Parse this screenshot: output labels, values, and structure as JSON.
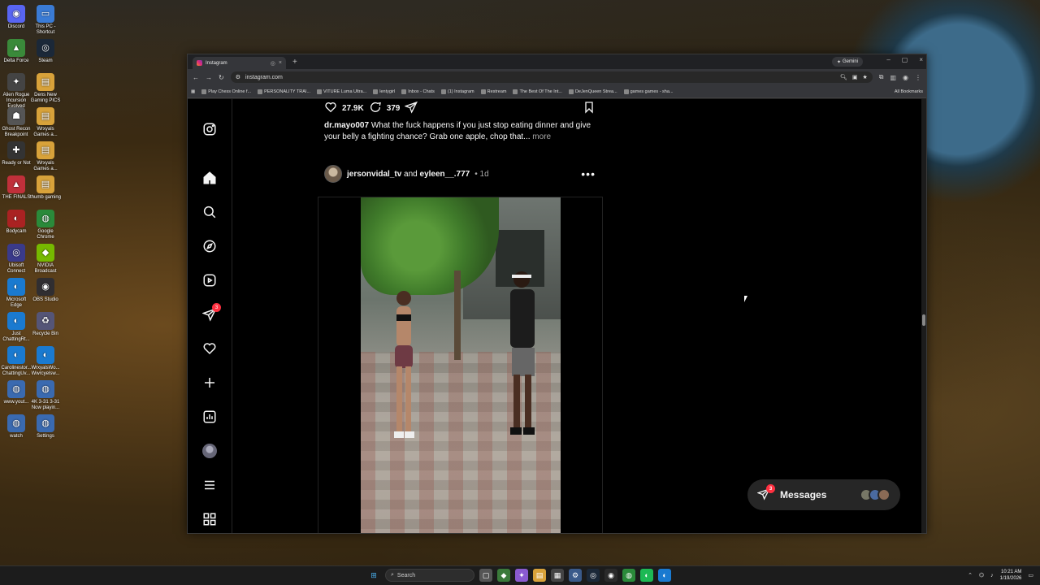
{
  "desktop": {
    "icons": [
      {
        "label": "Discord",
        "glyph": "◉",
        "color": "#5865f2"
      },
      {
        "label": "This PC - Shortcut",
        "glyph": "▭",
        "color": "#3a7bd5"
      },
      {
        "label": "Delta Force",
        "glyph": "▲",
        "color": "#3a8a3a"
      },
      {
        "label": "Steam",
        "glyph": "◎",
        "color": "#1b2838"
      },
      {
        "label": "Alien Rogue Incursion Evolved Edition",
        "glyph": "✦",
        "color": "#444"
      },
      {
        "label": "Dens New Gaming PICS",
        "glyph": "▤",
        "color": "#d8a23a"
      },
      {
        "label": "Ghost Recon Breakpoint",
        "glyph": "☗",
        "color": "#555"
      },
      {
        "label": "Wrxyals Games a...",
        "glyph": "▤",
        "color": "#d8a23a"
      },
      {
        "label": "Ready or Not",
        "glyph": "✚",
        "color": "#333"
      },
      {
        "label": "Wrxyals Games a...",
        "glyph": "▤",
        "color": "#d8a23a"
      },
      {
        "label": "THE FINALS",
        "glyph": "▲",
        "color": "#c0303a"
      },
      {
        "label": "thumb gaming",
        "glyph": "▤",
        "color": "#d8a23a"
      },
      {
        "label": "Bodycam",
        "glyph": "◐",
        "color": "#aa2222"
      },
      {
        "label": "Google Chrome",
        "glyph": "◍",
        "color": "#2a8a3a"
      },
      {
        "label": "Ubisoft Connect",
        "glyph": "◎",
        "color": "#3a3a8a"
      },
      {
        "label": "NVIDIA Broadcast",
        "glyph": "◆",
        "color": "#76b900"
      },
      {
        "label": "Microsoft Edge",
        "glyph": "◐",
        "color": "#1a7ad0"
      },
      {
        "label": "OBS Studio",
        "glyph": "◉",
        "color": "#302e31"
      },
      {
        "label": "Just ChattingRt...",
        "glyph": "◐",
        "color": "#1a7ad0"
      },
      {
        "label": "Recycle Bin",
        "glyph": "♻",
        "color": "#557"
      },
      {
        "label": "Carolinestor... ChattingUv...",
        "glyph": "◐",
        "color": "#1a7ad0"
      },
      {
        "label": "WrxyalsWo... Wwrcyelsw...",
        "glyph": "◐",
        "color": "#1a7ad0"
      },
      {
        "label": "www.yout...",
        "glyph": "◍",
        "color": "#3a6ab0"
      },
      {
        "label": "4K 3-31 3-31 Now playin...",
        "glyph": "◍",
        "color": "#3a6ab0"
      },
      {
        "label": "watch",
        "glyph": "◍",
        "color": "#3a6ab0"
      },
      {
        "label": "Settings",
        "glyph": "◍",
        "color": "#3a6ab0"
      }
    ]
  },
  "browser": {
    "tab_title": "Instagram",
    "tab_close": "×",
    "new_tab": "+",
    "gemini_label": "Gemini",
    "url": "instagram.com",
    "window_controls": [
      "–",
      "▢",
      "×"
    ],
    "bookmarks": [
      "Play Chess Online f...",
      "PERSONALITY TRAI...",
      "VITURE Luma Ultra...",
      "lentygirl",
      "Inbox - Chats",
      "(1) Instagram",
      "Restream",
      "The Best Of The Int...",
      "DeJenQueen Strea...",
      "games games - sha..."
    ],
    "all_bookmarks": "All Bookmarks"
  },
  "post_top": {
    "likes": "27.9K",
    "comments": "379",
    "caption_user": "dr.mayo007",
    "caption_text": "What the fuck happens if you just stop eating dinner and give your belly a fighting chance? Grab one apple, chop that...",
    "more": "more"
  },
  "post": {
    "user1": "jersonvidal_tv",
    "and": "and",
    "user2": "eyleen__.777",
    "time": "1d",
    "dots": "•••"
  },
  "rail": {
    "notif_count": "3"
  },
  "messages": {
    "label": "Messages",
    "badge": "3"
  },
  "taskbar": {
    "search_placeholder": "Search",
    "time": "10:21 AM",
    "date": "1/19/2026"
  }
}
